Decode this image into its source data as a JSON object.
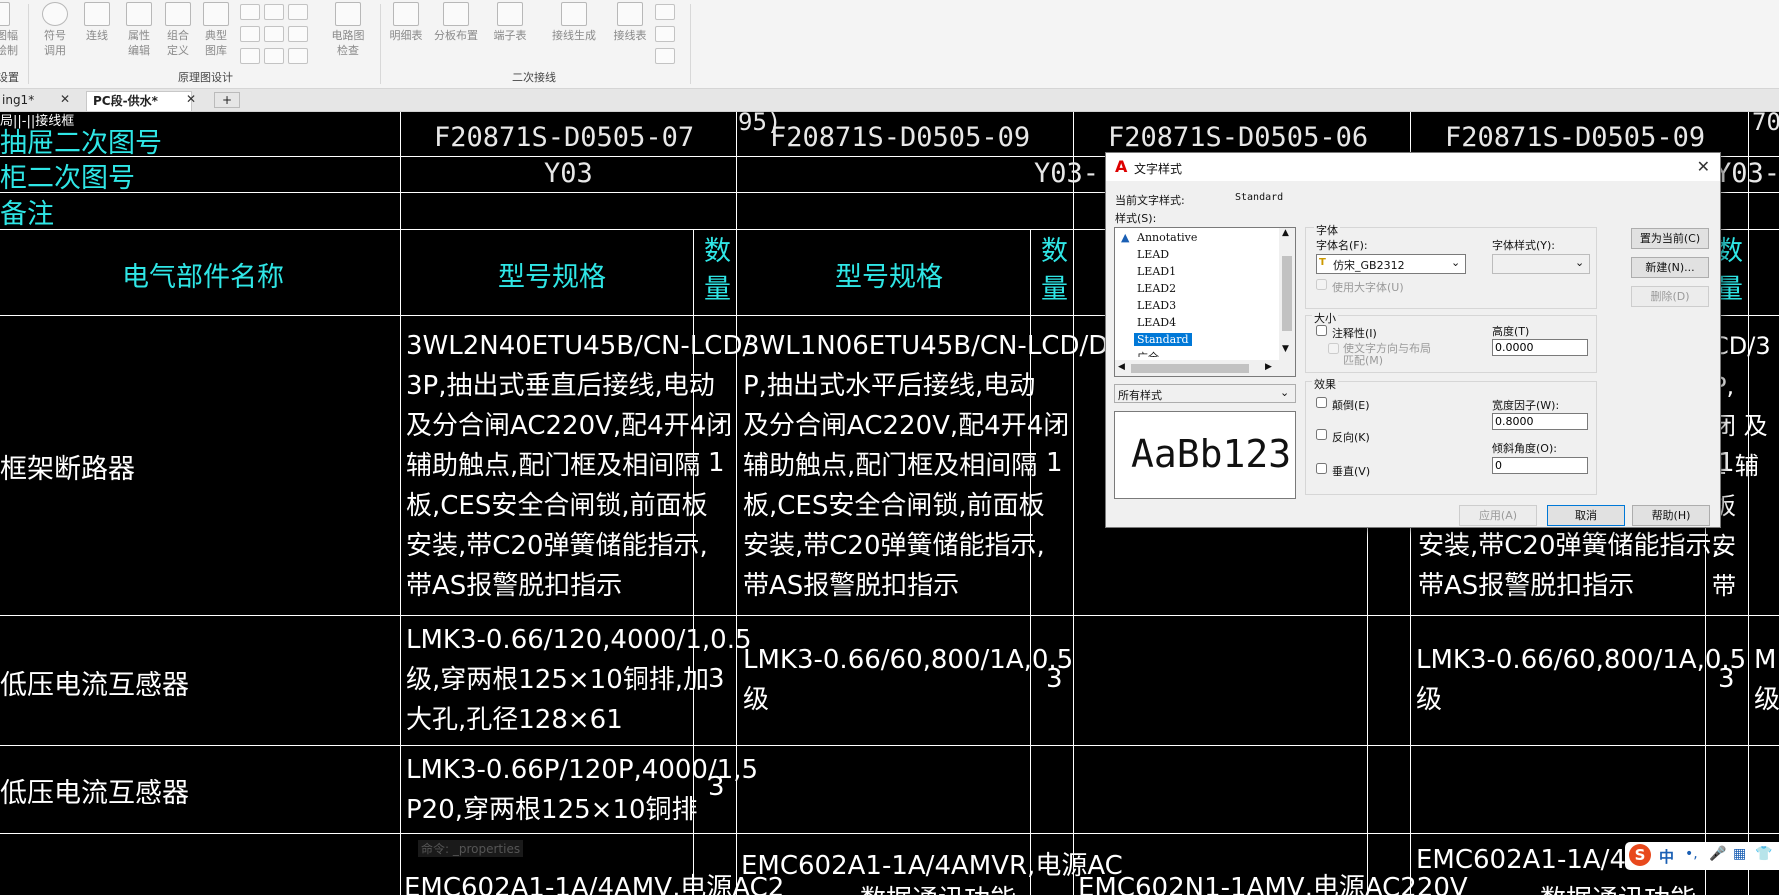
{
  "ribbon": {
    "buttons": [
      "符号\n调用",
      "连线",
      "属性\n编辑",
      "组合\n定义",
      "典型\n图库",
      "电路图\n检查",
      "明细表",
      "分板布置",
      "端子表",
      "接线生成",
      "接线表"
    ],
    "left_cut_label": "图幅\n绘制",
    "groups": {
      "setup": "设置",
      "schematic": "原理图设计",
      "secondary": "二次接线"
    }
  },
  "tabs": [
    {
      "label": "ing1*",
      "close": "✕"
    },
    {
      "label": "PC段-供水*",
      "close": "✕"
    },
    {
      "label": "+"
    }
  ],
  "canvas": {
    "top_fragment": "局||-||接线框",
    "stray_top": "95)",
    "row_labels": {
      "drawer_no": "抽屉二次图号",
      "cabinet_no": "柜二次图号",
      "remark": "备注"
    },
    "codes": [
      "F20871S-D0505-07",
      "F20871S-D0505-09",
      "F20871S-D0505-06",
      "F20871S-D0505-09"
    ],
    "code_edge": "70",
    "cabinet_values": [
      "Y03",
      "Y03-",
      "Y03-"
    ],
    "headers": {
      "name": "电气部件名称",
      "spec": "型号规格",
      "qty": "数\n量",
      "qty_right": "数\n量"
    },
    "rows": [
      {
        "name": "框架断路器",
        "spec1": "3WL2N40ETU45B/CN-LCD/\n3P,抽出式垂直后接线,电动\n及分合闸AC220V,配4开4闭\n辅助触点,配门框及相间隔\n板,CES安全合闸锁,前面板\n安装,带C20弹簧储能指示,\n带AS报警脱扣指示",
        "qty1": "1",
        "spec2": "3WL1N06ETU45B/CN-LCD/D\nP,抽出式水平后接线,电动\n及分合闸AC220V,配4开4闭\n辅助触点,配门框及相间隔\n板,CES安全合闸锁,前面板\n安装,带C20弹簧储能指示,\n带AS报警脱扣指示",
        "qty2": "1",
        "spec4_tail": "安装,带C20弹簧储能指示,\n带AS报警脱扣指示",
        "right_edge": "CD/3\n  P,\n闭 及\n 1 辅\n  板\n  安\n  带",
        "qty4": "1"
      },
      {
        "name": "低压电流互感器",
        "spec1": "LMK3-0.66/120,4000/1,0.5\n级,穿两根125×10铜排,加\n大孔,孔径128×61",
        "qty1": "3",
        "spec2": "LMK3-0.66/60,800/1A,0.5\n级",
        "qty2": "3",
        "spec4": "LMK3-0.66/60,800/1A,0.5\n级",
        "qty4": "3",
        "right_edge": "M\n级"
      },
      {
        "name": "低压电流互感器",
        "spec1": "LMK3-0.66P/120P,4000/1,5\nP20,穿两根125×10铜排",
        "qty1": "3"
      },
      {
        "name": "",
        "spec1": "EMC602A1-1A/4AMV,电源AC2",
        "spec2": "EMC602A1-1A/4AMVR,电源AC",
        "spec3": "EMC602N1-1AMV,电源AC220V",
        "spec4": "EMC602A1-1A/4",
        "spec2_tail": "数据通讯功能",
        "spec4_tail": "数据通讯功能",
        "tooltip": "命令: _properties"
      }
    ]
  },
  "dialog": {
    "title": "文字样式",
    "close": "✕",
    "current_style_label": "当前文字样式:",
    "current_style_value": "Standard",
    "styles_label": "样式(S):",
    "styles": [
      "Annotative",
      "LEAD",
      "LEAD1",
      "LEAD2",
      "LEAD3",
      "LEAD4",
      "Standard",
      "广全"
    ],
    "selected_style": "Standard",
    "filter": "所有样式",
    "preview": "AaBb123",
    "font_section": "字体",
    "font_name_label": "字体名(F):",
    "font_name_value": "仿宋_GB2312",
    "font_style_label": "字体样式(Y):",
    "font_style_value": "",
    "use_bigfont": "使用大字体(U)",
    "size_section": "大小",
    "annotative": "注释性(I)",
    "match_orientation": "使文字方向与布局\n匹配(M)",
    "height_label": "高度(T)",
    "height_value": "0.0000",
    "effects_section": "效果",
    "upside_down": "颠倒(E)",
    "backwards": "反向(K)",
    "vertical": "垂直(V)",
    "width_label": "宽度因子(W):",
    "width_value": "0.8000",
    "oblique_label": "倾斜角度(O):",
    "oblique_value": "0",
    "btn_set_current": "置为当前(C)",
    "btn_new": "新建(N)...",
    "btn_delete": "删除(D)",
    "btn_apply": "应用(A)",
    "btn_cancel": "取消",
    "btn_help": "帮助(H)"
  },
  "ime": {
    "logo": "S",
    "lang": "中",
    "items": [
      "•,",
      "🎤",
      "▦",
      "👕"
    ]
  }
}
